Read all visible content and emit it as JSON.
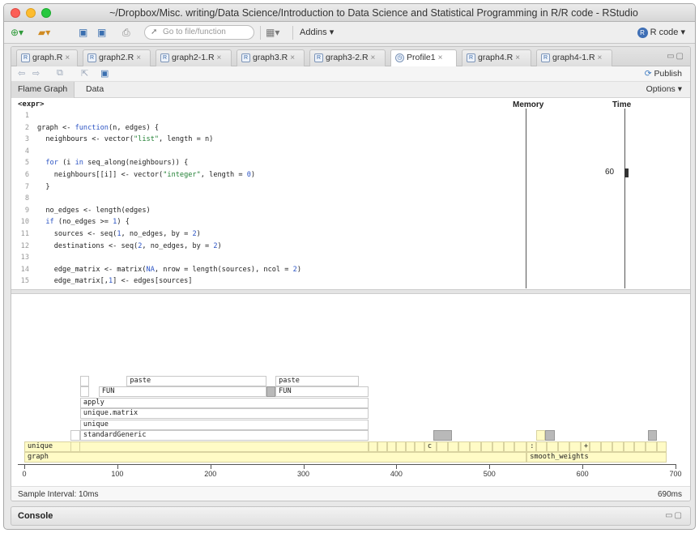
{
  "window": {
    "title": "~/Dropbox/Misc. writing/Data Science/Introduction to Data Science and Statistical Programming in R/R code - RStudio"
  },
  "toolbar": {
    "goto_placeholder": "Go to file/function",
    "addins_label": "Addins ▾",
    "project_label": "R code ▾"
  },
  "tabs": [
    {
      "label": "graph.R",
      "active": false
    },
    {
      "label": "graph2.R",
      "active": false
    },
    {
      "label": "graph2-1.R",
      "active": false
    },
    {
      "label": "graph3.R",
      "active": false
    },
    {
      "label": "graph3-2.R",
      "active": false
    },
    {
      "label": "Profile1",
      "active": true
    },
    {
      "label": "graph4.R",
      "active": false
    },
    {
      "label": "graph4-1.R",
      "active": false
    }
  ],
  "profile_toolbar": {
    "publish_label": "Publish"
  },
  "view_tabs": {
    "flame": "Flame Graph",
    "data": "Data",
    "options": "Options ▾"
  },
  "code_header": {
    "expr": "<expr>",
    "memory": "Memory",
    "time": "Time"
  },
  "code_lines": [
    {
      "n": "1",
      "text": ""
    },
    {
      "n": "2",
      "text": "graph <- function(n, edges) {"
    },
    {
      "n": "3",
      "text": "  neighbours <- vector(\"list\", length = n)"
    },
    {
      "n": "4",
      "text": ""
    },
    {
      "n": "5",
      "text": "  for (i in seq_along(neighbours)) {"
    },
    {
      "n": "6",
      "text": "    neighbours[[i]] <- vector(\"integer\", length = 0)"
    },
    {
      "n": "7",
      "text": "  }"
    },
    {
      "n": "8",
      "text": ""
    },
    {
      "n": "9",
      "text": "  no_edges <- length(edges)"
    },
    {
      "n": "10",
      "text": "  if (no_edges >= 1) {"
    },
    {
      "n": "11",
      "text": "    sources <- seq(1, no_edges, by = 2)"
    },
    {
      "n": "12",
      "text": "    destinations <- seq(2, no_edges, by = 2)"
    },
    {
      "n": "13",
      "text": ""
    },
    {
      "n": "14",
      "text": "    edge_matrix <- matrix(NA, nrow = length(sources), ncol = 2)"
    },
    {
      "n": "15",
      "text": "    edge_matrix[,1] <- edges[sources]"
    }
  ],
  "time_value": "60",
  "flame": {
    "frames": [
      {
        "label": "graph",
        "start": 0,
        "end": 540,
        "depth": 0,
        "style": "y"
      },
      {
        "label": "smooth_weights",
        "start": 540,
        "end": 690,
        "depth": 0,
        "style": "y"
      },
      {
        "label": "unique",
        "start": 0,
        "end": 370,
        "depth": 1,
        "style": "y"
      },
      {
        "label": "c",
        "start": 430,
        "end": 443,
        "depth": 1,
        "style": "y"
      },
      {
        "label": ":",
        "start": 540,
        "end": 550,
        "depth": 1,
        "style": "y"
      },
      {
        "label": "+",
        "start": 598,
        "end": 608,
        "depth": 1,
        "style": "y"
      },
      {
        "label": "standardGeneric",
        "start": 60,
        "end": 370,
        "depth": 2,
        "style": "w"
      },
      {
        "label": "unique",
        "start": 60,
        "end": 370,
        "depth": 3,
        "style": "w"
      },
      {
        "label": "unique.matrix",
        "start": 60,
        "end": 370,
        "depth": 4,
        "style": "w"
      },
      {
        "label": "apply",
        "start": 60,
        "end": 370,
        "depth": 5,
        "style": "w"
      },
      {
        "label": "FUN",
        "start": 80,
        "end": 260,
        "depth": 6,
        "style": "w"
      },
      {
        "label": "FUN",
        "start": 270,
        "end": 370,
        "depth": 6,
        "style": "w"
      },
      {
        "label": "paste",
        "start": 110,
        "end": 260,
        "depth": 7,
        "style": "w"
      },
      {
        "label": "paste",
        "start": 270,
        "end": 360,
        "depth": 7,
        "style": "w"
      }
    ],
    "axis_ticks": [
      "0",
      "100",
      "200",
      "300",
      "400",
      "500",
      "600",
      "700"
    ],
    "axis_max": 700
  },
  "status": {
    "sample_interval": "Sample Interval: 10ms",
    "total_time": "690ms"
  },
  "console": {
    "title": "Console"
  },
  "colors": {
    "frame_yellow": "#fffbc6",
    "frame_gray": "#b9b9b9",
    "keyword_blue": "#2c54c4",
    "string_green": "#1f7f32"
  }
}
